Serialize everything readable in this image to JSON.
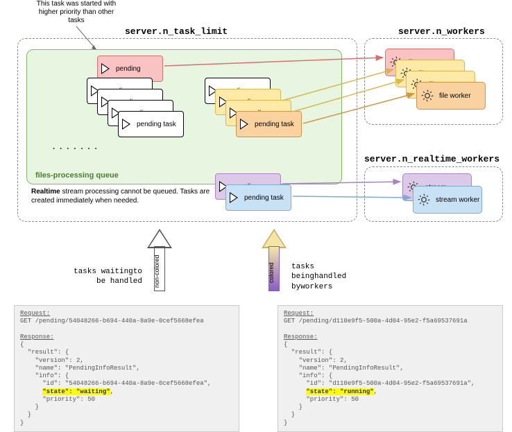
{
  "titles": {
    "main": "server.n_task_limit",
    "workers": "server.n_workers",
    "rt_workers": "server.n_realtime_workers"
  },
  "annotation": "This task was started with higher priority than other tasks",
  "dots": ". . . . . . .",
  "queue_label": "files-processing queue",
  "rt_note_bold": "Realtime",
  "rt_note_rest": " stream processing cannot be queued. Tasks are created immediately when needed.",
  "task_labels": {
    "pending": "pending",
    "pending_task": "pending task"
  },
  "worker_labels": {
    "file": "file",
    "file_worker": "file worker",
    "stream": "stream",
    "stream_worker": "stream worker"
  },
  "big_arrows": {
    "left_vlabel": "non-colored",
    "right_vlabel": "colored",
    "left_text": "tasks waiting\nto be handled",
    "right_text": "tasks being\nhandled by\nworkers"
  },
  "code": {
    "left": {
      "req_label": "Request:",
      "req": "GET /pending/54048266-b694-440a-8a9e-0cef5668efea",
      "resp_label": "Response:",
      "body": "{\n  \"result\": {\n    \"version\": 2,\n    \"name\": \"PendingInfoResult\",\n    \"info\": {\n      \"id\": \"54048266-b694-440a-8a9e-0cef5668efea\",\n      ",
      "highlight": "\"state\": \"waiting\"",
      "tail": ",\n      \"priority\": 50\n    }\n  }\n}"
    },
    "right": {
      "req_label": "Request:",
      "req": "GET /pending/d110e9f5-500a-4d04-95e2-f5a69537691a",
      "resp_label": "Response:",
      "body": "{\n  \"result\": {\n    \"version\": 2,\n    \"name\": \"PendingInfoResult\",\n    \"info\": {\n      \"id\": \"d110e9f5-500a-4d04-95e2-f5a69537691a\",\n      ",
      "highlight": "\"state\": \"running\"",
      "tail": ",\n      \"priority\": 50\n    }\n  }\n}"
    }
  },
  "colors": {
    "red": "#d97070",
    "yellow": "#d6b84e",
    "orange": "#d19546",
    "purple": "#a883c4",
    "blue": "#7aacd4"
  }
}
